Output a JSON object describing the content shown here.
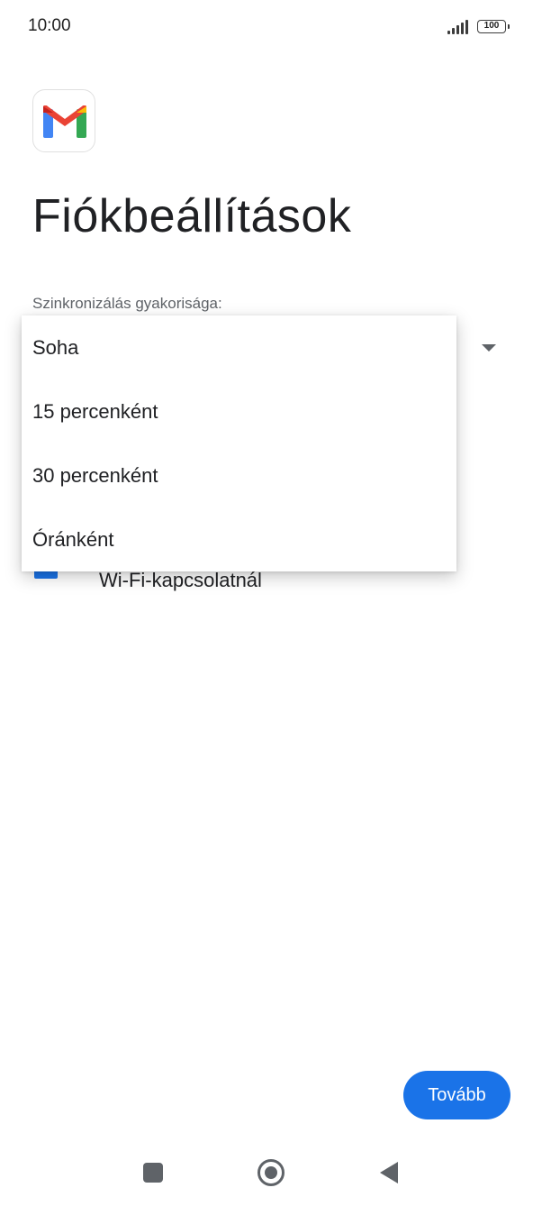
{
  "status_bar": {
    "time": "10:00",
    "battery": "100"
  },
  "page": {
    "title": "Fiókbeállítások",
    "sync_label": "Szinkronizálás gyakorisága:",
    "wifi_label": "Wi-Fi-kapcsolatnál"
  },
  "dropdown": {
    "options": [
      "Soha",
      "15 percenként",
      "30 percenként",
      "Óránként"
    ]
  },
  "actions": {
    "next_label": "Tovább"
  },
  "colors": {
    "accent": "#1a73e8",
    "text": "#202124",
    "secondary_text": "#5f6368"
  },
  "icons": {
    "app": "gmail-icon",
    "signal": "signal-icon",
    "battery": "battery-icon",
    "nav_recent": "recent-apps-icon",
    "nav_home": "home-icon",
    "nav_back": "back-icon",
    "dropdown_arrow": "dropdown-arrow-icon"
  }
}
